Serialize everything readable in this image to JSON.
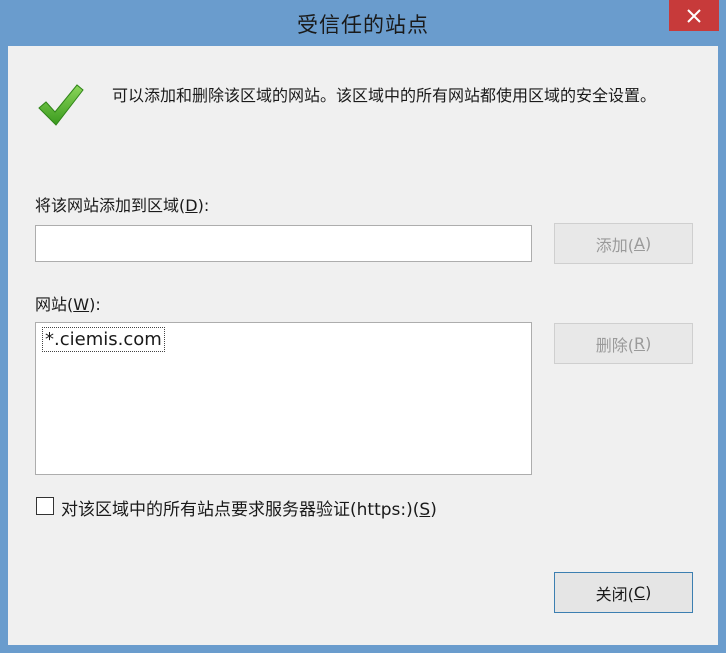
{
  "window": {
    "title": "受信任的站点",
    "close_icon": "close-icon"
  },
  "info": {
    "icon": "checkmark-icon",
    "text": "可以添加和删除该区域的网站。该区域中的所有网站都使用区域的安全设置。"
  },
  "add_section": {
    "label_prefix": "将该网站添加到区域(",
    "label_hotkey": "D",
    "label_suffix": "):",
    "input_value": "",
    "add_prefix": "添加(",
    "add_hotkey": "A",
    "add_suffix": ")"
  },
  "sites_section": {
    "label_prefix": "网站(",
    "label_hotkey": "W",
    "label_suffix": "):",
    "items": [
      "*.ciemis.com"
    ],
    "remove_prefix": "删除(",
    "remove_hotkey": "R",
    "remove_suffix": ")"
  },
  "https_check": {
    "checked": false,
    "label_prefix": "对该区域中的所有站点要求服务器验证(https:)(",
    "label_hotkey": "S",
    "label_suffix": ")"
  },
  "footer": {
    "close_prefix": "关闭(",
    "close_hotkey": "C",
    "close_suffix": ")"
  },
  "colors": {
    "frame": "#6a9ccd",
    "close_button": "#c73a3a",
    "client_bg": "#f0f0f0",
    "checkmark": "#4caf2a"
  }
}
